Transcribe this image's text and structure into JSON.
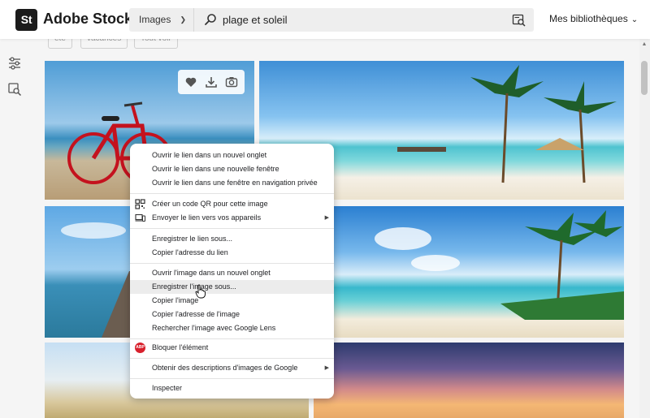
{
  "app": {
    "logo_mark": "St",
    "brand_name": "Adobe Stock"
  },
  "search": {
    "category_selected": "Images",
    "query": "plage et soleil"
  },
  "header": {
    "libraries_label": "Mes bibliothèques"
  },
  "filters": {
    "chips": [
      "été",
      "vacances",
      "Tout voir"
    ]
  },
  "context_menu": {
    "items": [
      "Ouvrir le lien dans un nouvel onglet",
      "Ouvrir le lien dans une nouvelle fenêtre",
      "Ouvrir le lien dans une fenêtre en navigation privée",
      "Créer un code QR pour cette image",
      "Envoyer le lien vers vos appareils",
      "Enregistrer le lien sous...",
      "Copier l'adresse du lien",
      "Ouvrir l'image dans un nouvel onglet",
      "Enregistrer l'image sous...",
      "Copier l'image",
      "Copier l'adresse de l'image",
      "Rechercher l'image avec Google Lens",
      "Bloquer l'élément",
      "Obtenir des descriptions d'images de Google",
      "Inspecter"
    ],
    "abp_badge": "ABP",
    "highlighted_item": "Enregistrer l'image sous..."
  },
  "colors": {
    "header_bg": "#ffffff",
    "page_bg": "#f5f5f5",
    "abp_red": "#d8202c",
    "menu_hover": "#ececec"
  },
  "icons": {
    "search": "search-icon",
    "visual_search": "visual-search-icon",
    "filters": "filter-sliders-icon",
    "similar": "similar-search-icon",
    "like": "heart-icon",
    "download": "download-icon",
    "find_similar": "camera-icon",
    "qr": "qr-code-icon",
    "send_devices": "devices-icon"
  }
}
